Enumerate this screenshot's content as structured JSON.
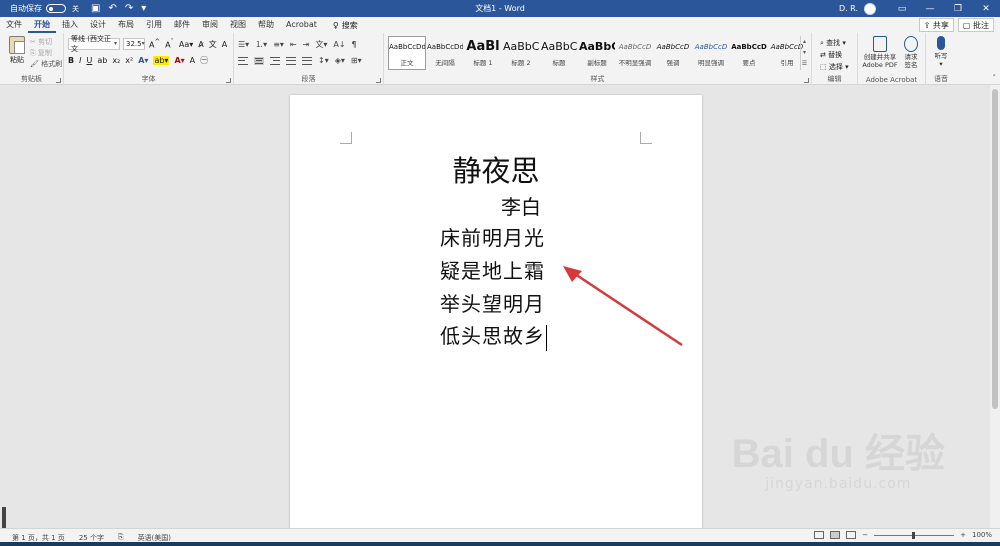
{
  "titlebar": {
    "autosave_label": "自动保存",
    "autosave_state": "关",
    "doc_title": "文档1 - Word",
    "user_name": "D. R.",
    "quick_access": [
      "save-icon",
      "undo-icon",
      "redo-icon",
      "customize-icon"
    ],
    "window_controls": [
      "ribbon-display-icon",
      "minimize-icon",
      "restore-icon",
      "close-icon"
    ]
  },
  "tabs": [
    "文件",
    "开始",
    "插入",
    "设计",
    "布局",
    "引用",
    "邮件",
    "审阅",
    "视图",
    "帮助",
    "Acrobat"
  ],
  "active_tab": "开始",
  "search_label": "搜索",
  "share_label": "共享",
  "comments_label": "批注",
  "ribbon": {
    "clipboard": {
      "label": "剪贴板",
      "paste": "粘贴",
      "cut": "剪切",
      "copy": "复制",
      "format_painter": "格式刷"
    },
    "font": {
      "label": "字体",
      "font_name": "等线 (西文正文",
      "font_size": "32.5"
    },
    "paragraph": {
      "label": "段落"
    },
    "styles": {
      "label": "样式",
      "items": [
        {
          "sample": "AaBbCcDd",
          "name": "正文"
        },
        {
          "sample": "AaBbCcDd",
          "name": "无间隔"
        },
        {
          "sample": "AaBl",
          "name": "标题 1"
        },
        {
          "sample": "AaBbC",
          "name": "标题 2"
        },
        {
          "sample": "AaBbC",
          "name": "标题"
        },
        {
          "sample": "AaBbC",
          "name": "副标题"
        },
        {
          "sample": "AaBbCcD",
          "name": "不明显强调"
        },
        {
          "sample": "AaBbCcD",
          "name": "强调"
        },
        {
          "sample": "AaBbCcD",
          "name": "明显强调"
        },
        {
          "sample": "AaBbCcD",
          "name": "要点"
        },
        {
          "sample": "AaBbCcD",
          "name": "引用"
        }
      ]
    },
    "editing": {
      "label": "编辑",
      "find": "查找",
      "replace": "替换",
      "select": "选择"
    },
    "acrobat": {
      "label": "Adobe Acrobat",
      "create_share": "创建并共享",
      "create_share_2": "Adobe PDF",
      "request": "请求",
      "request_2": "签名"
    },
    "voice": {
      "label": "语音",
      "dictate": "听写"
    }
  },
  "document": {
    "title": "静夜思",
    "author": "李白",
    "lines": [
      "床前明月光",
      "疑是地上霜",
      "举头望明月",
      "低头思故乡"
    ]
  },
  "status": {
    "page": "第 1 页，共 1 页",
    "words": "25 个字",
    "language": "英语(美国)",
    "zoom": "100%"
  },
  "watermark": {
    "main": "Bai du 经验",
    "sub": "jingyan.baidu.com"
  },
  "colors": {
    "accent": "#2b579a",
    "annotation_arrow": "#d9383a"
  }
}
